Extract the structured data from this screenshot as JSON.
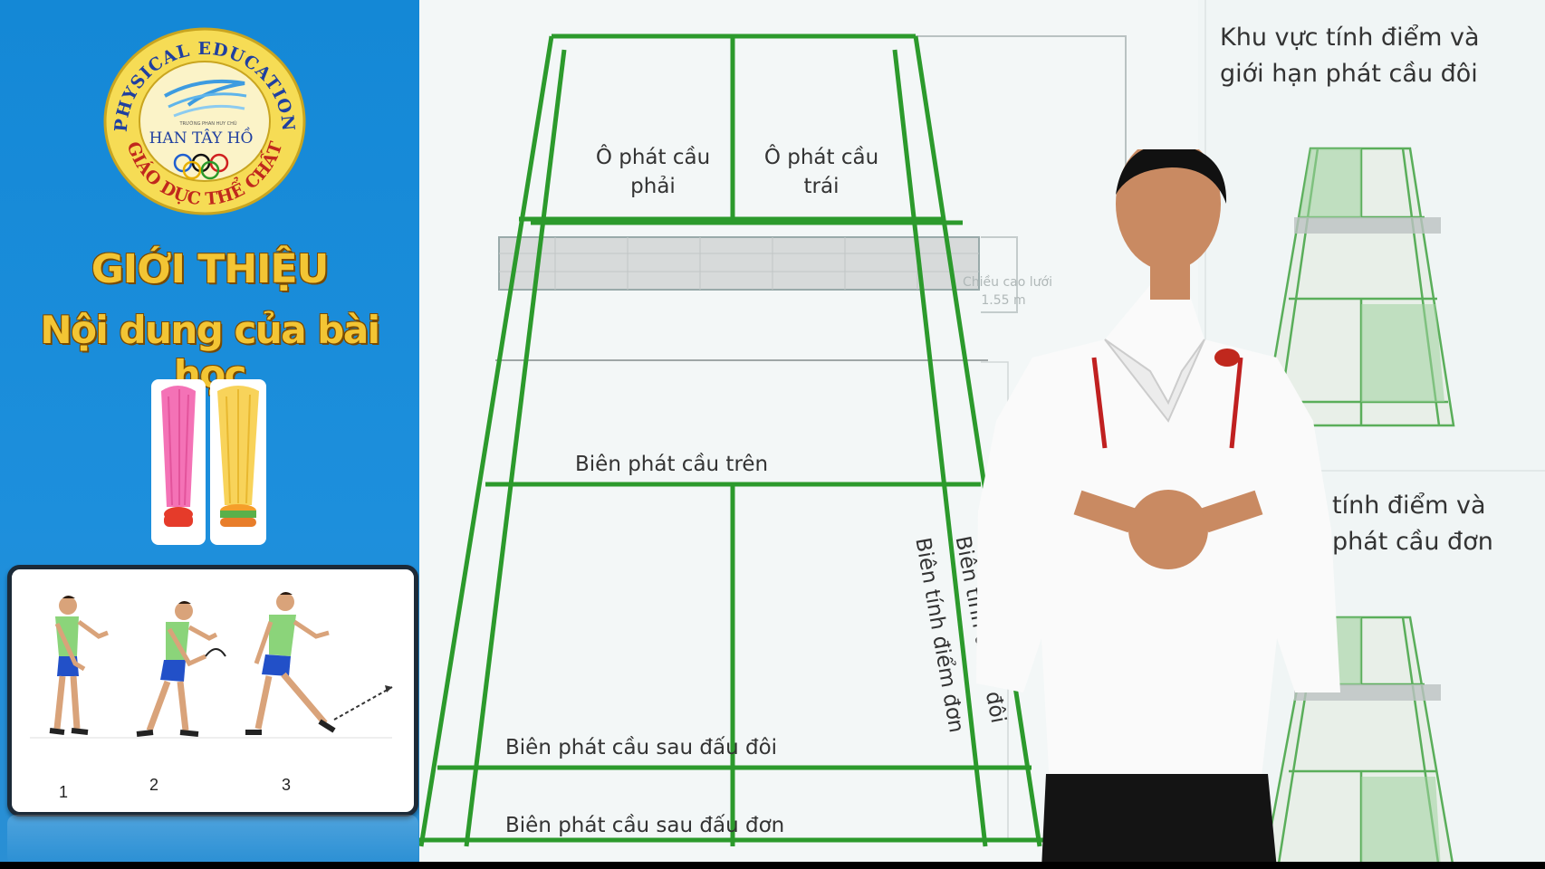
{
  "logo": {
    "arc_top": "PHYSICAL EDUCATION",
    "arc_bottom": "GIÁO DỤC THỂ CHẤT",
    "small_text": "TRƯỜNG PHAN HUY CHÚ",
    "center_text": "HAN TÂY HỒ"
  },
  "sidebar": {
    "title": "GIỚI THIỆU",
    "subtitle": "Nội dung của bài học",
    "steps": [
      "1",
      "2",
      "3"
    ],
    "colors": {
      "background": "#1a8ad8",
      "title": "#f3c534"
    }
  },
  "court": {
    "service_box_right": [
      "Ô phát cầu",
      "phải"
    ],
    "service_box_left": [
      "Ô phát cầu",
      "trái"
    ],
    "net_height_label": [
      "Chiều cao lưới",
      "1.55 m"
    ],
    "upper_service_line": "Biên phát cầu trên",
    "doubles_long_service_line": "Biên phát cầu sau đấu đôi",
    "singles_long_service_line": "Biên phát cầu sau đấu đơn",
    "singles_sideline": "Biên tính điểm đơn",
    "doubles_sideline": "Biên tính điểm đôi",
    "line_color": "#2c9a2c"
  },
  "legend": {
    "doubles": [
      "Khu vực tính điểm và",
      "giới hạn phát cầu đôi"
    ],
    "singles": [
      "tính điểm và",
      "phát cầu đơn"
    ]
  }
}
